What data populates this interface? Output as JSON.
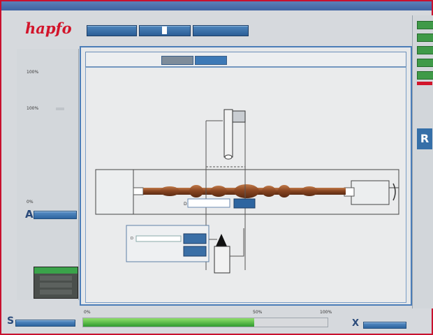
{
  "app": {
    "title": "",
    "logo_text": "hapfo",
    "brand_color": "#d2142a",
    "accent_color": "#3d79b6"
  },
  "toolbar": {
    "buttons": [
      {
        "label": "",
        "icon": "tool-mode-button"
      },
      {
        "label": "",
        "icon": "toggle-switch"
      },
      {
        "label": "",
        "icon": "program-button"
      }
    ]
  },
  "left_panel": {
    "label_top": "100%",
    "label_mid": "100%",
    "label_axis": "0%",
    "axis_a": "A",
    "greenbox_header": "",
    "greenbox_rows": [
      "",
      "",
      ""
    ]
  },
  "work_area": {
    "tabs": [
      "",
      ""
    ],
    "diameter_readout": {
      "label": "D",
      "value": ""
    },
    "dialog": {
      "title": "",
      "field_label": "D",
      "field_value": ""
    }
  },
  "bottom": {
    "axis_s": "S",
    "progress_labels": [
      "0%",
      "50%",
      "100%"
    ],
    "progress_value": 0.7,
    "axis_x": "X"
  },
  "right_panel": {
    "green_buttons": [
      "",
      "",
      "",
      "",
      ""
    ],
    "big_label": "R"
  }
}
